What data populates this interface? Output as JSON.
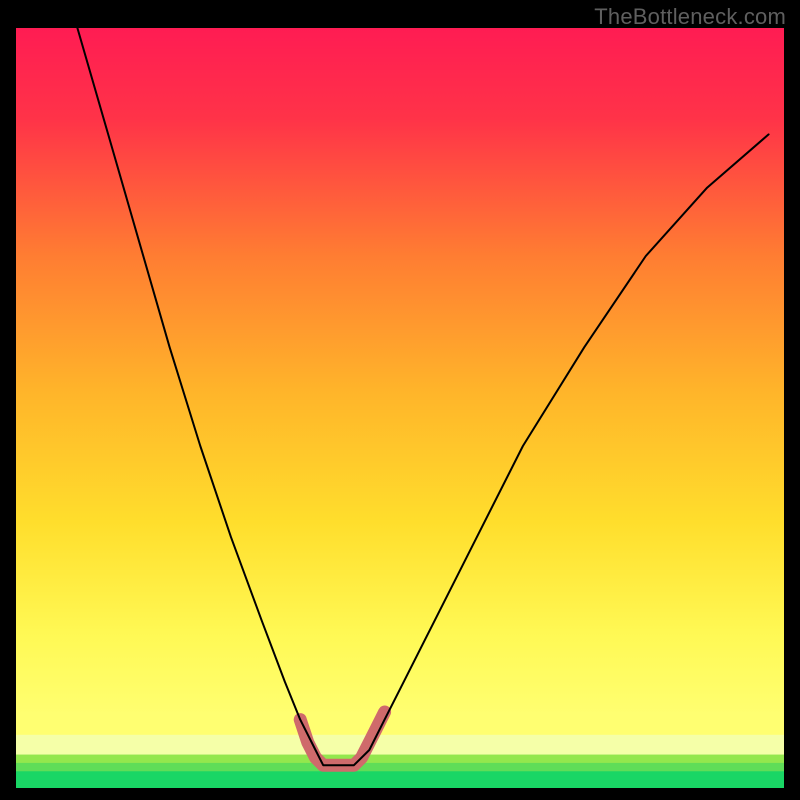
{
  "watermark": "TheBottleneck.com",
  "chart_data": {
    "type": "line",
    "title": "",
    "xlabel": "",
    "ylabel": "",
    "xlim": [
      0,
      100
    ],
    "ylim": [
      0,
      100
    ],
    "background_gradient": {
      "top_color": "#ff1c53",
      "mid_color": "#ffe331",
      "bottom_color": "#19d665"
    },
    "series": [
      {
        "name": "bottleneck-curve",
        "x": [
          8,
          12,
          16,
          20,
          24,
          28,
          32,
          35,
          37,
          39,
          40,
          42,
          44,
          46,
          48,
          50,
          54,
          60,
          66,
          74,
          82,
          90,
          98
        ],
        "y": [
          100,
          86,
          72,
          58,
          45,
          33,
          22,
          14,
          9,
          5,
          3,
          3,
          3,
          5,
          9,
          13,
          21,
          33,
          45,
          58,
          70,
          79,
          86
        ],
        "stroke": "#000000",
        "stroke_width": 2
      },
      {
        "name": "optimal-zone-marker",
        "x": [
          37,
          38,
          39,
          40,
          41,
          42,
          43,
          44,
          45,
          46,
          47,
          48
        ],
        "y": [
          9,
          6,
          4,
          3,
          3,
          3,
          3,
          3,
          4,
          6,
          8,
          10
        ],
        "stroke": "#cf6a6b",
        "stroke_width": 13
      }
    ],
    "bottom_bands": [
      {
        "y": 2.2,
        "color": "#19d665"
      },
      {
        "y": 3.3,
        "color": "#5fdd58"
      },
      {
        "y": 4.4,
        "color": "#93e74d"
      },
      {
        "y": 7.0,
        "color": "#f5ffa8"
      },
      {
        "y": 10.0,
        "color": "#ffff71"
      }
    ]
  }
}
